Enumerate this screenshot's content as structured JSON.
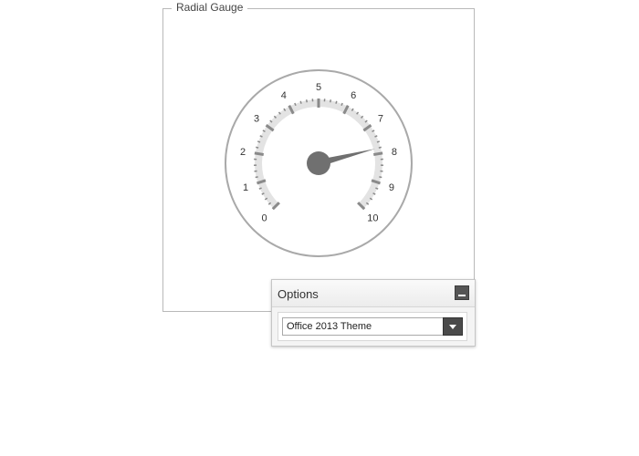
{
  "group": {
    "title": "Radial Gauge"
  },
  "gauge": {
    "min": 0,
    "max": 10,
    "value": 7.8,
    "labels": [
      "0",
      "1",
      "2",
      "3",
      "4",
      "5",
      "6",
      "7",
      "8",
      "9",
      "10"
    ],
    "colors": {
      "ring": "#a9a9a9",
      "band": "#e3e3e3",
      "tick": "#8a8a8a",
      "needle": "#707070"
    }
  },
  "options": {
    "title": "Options",
    "theme_selected": "Office 2013 Theme"
  }
}
